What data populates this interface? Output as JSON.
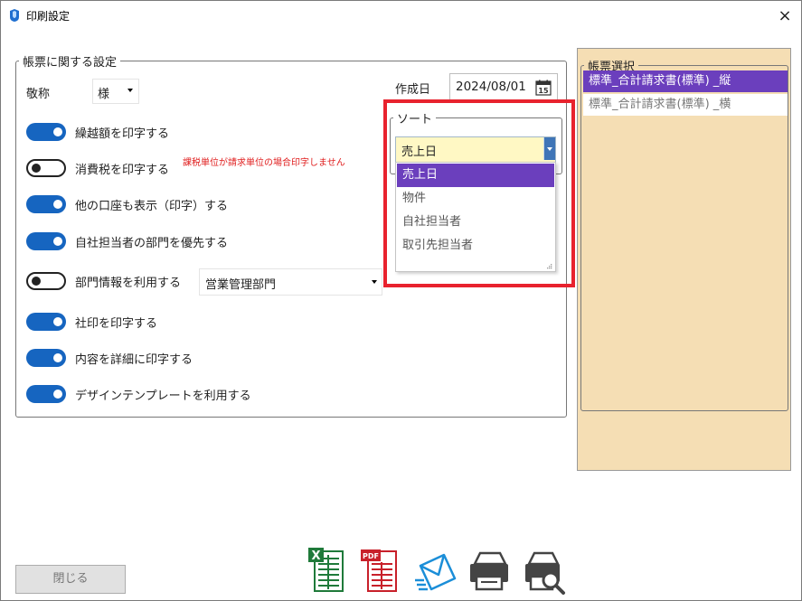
{
  "window": {
    "title": "印刷設定",
    "close_symbol": "×"
  },
  "settings": {
    "legend": "帳票に関する設定",
    "honorific": {
      "label": "敬称",
      "value": "様"
    },
    "date": {
      "label": "作成日",
      "value": "2024/08/01",
      "calendar_day": "15"
    },
    "toggles": [
      {
        "label": "繰越額を印字する",
        "on": true
      },
      {
        "label": "消費税を印字する",
        "on": false,
        "note": "課税単位が請求単位の場合印字しません"
      },
      {
        "label": "他の口座も表示（印字）する",
        "on": true
      },
      {
        "label": "自社担当者の部門を優先する",
        "on": true
      },
      {
        "label": "部門情報を利用する",
        "on": false,
        "select_value": "営業管理部門"
      },
      {
        "label": "社印を印字する",
        "on": true
      },
      {
        "label": "内容を詳細に印字する",
        "on": true
      },
      {
        "label": "デザインテンプレートを利用する",
        "on": true
      }
    ]
  },
  "sort": {
    "legend": "ソート",
    "value": "売上日",
    "options": [
      "売上日",
      "物件",
      "自社担当者",
      "取引先担当者"
    ],
    "selected_index": 0
  },
  "templates": {
    "legend": "帳票選択",
    "items": [
      "標準_合計請求書(標準) _縦",
      "標準_合計請求書(標準) _横"
    ],
    "selected_index": 0
  },
  "footer": {
    "close_label": "閉じる",
    "actions": [
      "excel-export",
      "pdf-export",
      "email-send",
      "print",
      "print-preview"
    ]
  },
  "colors": {
    "toggle_on": "#1665c0",
    "selection": "#6b3fbd",
    "highlight": "#e8222e",
    "panel_bg": "#f5deb4",
    "combo_bg": "#fff8c4"
  }
}
